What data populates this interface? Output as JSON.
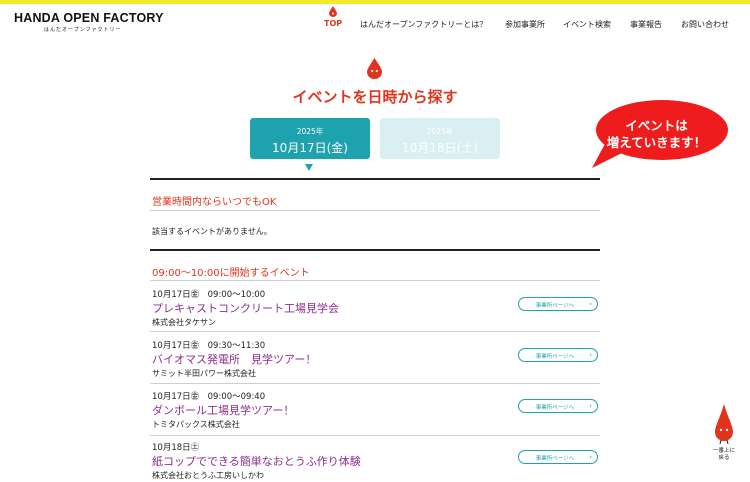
{
  "header": {
    "logo_main": "HANDA OPEN FACTORY",
    "logo_sub": "はんだオープンファクトリー",
    "nav": [
      {
        "label": "TOP",
        "active": true
      },
      {
        "label": "はんだオープンファクトリーとは？"
      },
      {
        "label": "参加事業所"
      },
      {
        "label": "イベント検索"
      },
      {
        "label": "事業報告"
      },
      {
        "label": "お問い合わせ"
      }
    ]
  },
  "section": {
    "title": "イベントを日時から探す"
  },
  "date_tabs": [
    {
      "year": "2025年",
      "day": "10月17日(金)",
      "selected": true
    },
    {
      "year": "2025年",
      "day": "10月18日(土)",
      "selected": false
    }
  ],
  "bubble": {
    "line1": "イベントは",
    "line2": "増えていきます！"
  },
  "groups": {
    "anytime": {
      "heading": "営業時間内ならいつでもOK",
      "empty_text": "該当するイベントがありません。"
    },
    "nine": {
      "heading": "09:00〜10:00に開始するイベント"
    }
  },
  "events": [
    {
      "date": "10月17日㊎　09:00〜10:00",
      "title": "プレキャストコンクリート工場見学会",
      "company": "株式会社タケサン",
      "button": "事業所ページへ"
    },
    {
      "date": "10月17日㊎　09:30〜11:30",
      "title": "バイオマス発電所　見学ツアー！",
      "company": "サミット半田パワー株式会社",
      "button": "事業所ページへ"
    },
    {
      "date": "10月17日㊎　09:00〜09:40",
      "title": "ダンボール工場見学ツアー！",
      "company": "トミタパックス株式会社",
      "button": "事業所ページへ"
    },
    {
      "date": "10月18日㊏",
      "title": "紙コップでできる簡単なおとうふ作り体験",
      "company": "株式会社おとうふ工房いしかわ",
      "button": "事業所ページへ"
    }
  ],
  "back_to_top": {
    "line1": "一番上に",
    "line2": "戻る"
  },
  "colors": {
    "accent_red": "#e2341d",
    "teal": "#1ea2ae",
    "title_purple": "#8e2d8e",
    "top_bar": "#f5ea2a"
  },
  "icons": {
    "nav_marker": "red-drop-icon",
    "section_marker": "red-drop-icon",
    "button_chevron": "chevron-right-icon",
    "back_to_top": "mascot-icon"
  }
}
